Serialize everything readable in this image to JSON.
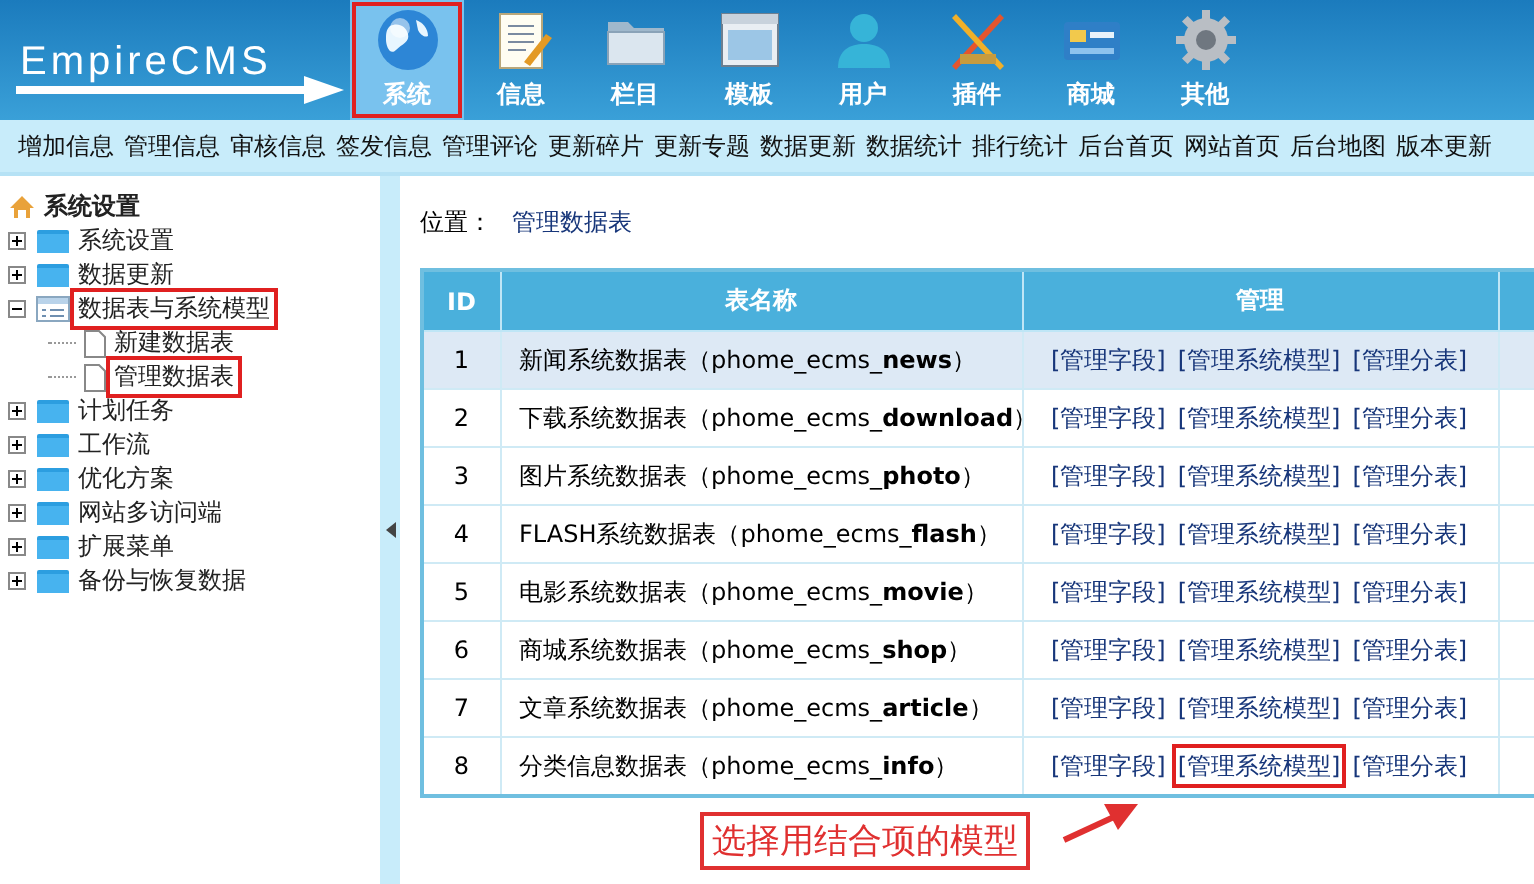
{
  "logo": {
    "text": "EmpireCMS"
  },
  "nav": [
    {
      "label": "系统",
      "selected": true,
      "highlighted": true
    },
    {
      "label": "信息",
      "selected": false,
      "highlighted": false
    },
    {
      "label": "栏目",
      "selected": false,
      "highlighted": false
    },
    {
      "label": "模板",
      "selected": false,
      "highlighted": false
    },
    {
      "label": "用户",
      "selected": false,
      "highlighted": false
    },
    {
      "label": "插件",
      "selected": false,
      "highlighted": false
    },
    {
      "label": "商城",
      "selected": false,
      "highlighted": false
    },
    {
      "label": "其他",
      "selected": false,
      "highlighted": false
    }
  ],
  "quick_links": [
    "增加信息",
    "管理信息",
    "审核信息",
    "签发信息",
    "管理评论",
    "更新碎片",
    "更新专题",
    "数据更新",
    "数据统计",
    "排行统计",
    "后台首页",
    "网站首页",
    "后台地图",
    "版本更新"
  ],
  "sidebar": {
    "root": "系统设置",
    "items": [
      {
        "label": "系统设置",
        "expanded": false,
        "highlighted": false
      },
      {
        "label": "数据更新",
        "expanded": false,
        "highlighted": false
      },
      {
        "label": "数据表与系统模型",
        "expanded": true,
        "highlighted": true,
        "children": [
          {
            "label": "新建数据表",
            "highlighted": false
          },
          {
            "label": "管理数据表",
            "highlighted": true
          }
        ]
      },
      {
        "label": "计划任务",
        "expanded": false,
        "highlighted": false
      },
      {
        "label": "工作流",
        "expanded": false,
        "highlighted": false
      },
      {
        "label": "优化方案",
        "expanded": false,
        "highlighted": false
      },
      {
        "label": "网站多访问端",
        "expanded": false,
        "highlighted": false
      },
      {
        "label": "扩展菜单",
        "expanded": false,
        "highlighted": false
      },
      {
        "label": "备份与恢复数据",
        "expanded": false,
        "highlighted": false
      }
    ]
  },
  "breadcrumb": {
    "label": "位置：",
    "link": "管理数据表"
  },
  "table": {
    "columns": [
      "ID",
      "表名称",
      "管理"
    ],
    "rows": [
      {
        "id": "1",
        "name": "新闻系统数据表（phome_ecms_**news**）",
        "selected": true,
        "actions": [
          {
            "label": "[管理字段]",
            "highlighted": false
          },
          {
            "label": "[管理系统模型]",
            "highlighted": false
          },
          {
            "label": "[管理分表]",
            "highlighted": false
          }
        ]
      },
      {
        "id": "2",
        "name": "下载系统数据表（phome_ecms_**download**）",
        "selected": false,
        "actions": [
          {
            "label": "[管理字段]",
            "highlighted": false
          },
          {
            "label": "[管理系统模型]",
            "highlighted": false
          },
          {
            "label": "[管理分表]",
            "highlighted": false
          }
        ]
      },
      {
        "id": "3",
        "name": "图片系统数据表（phome_ecms_**photo**）",
        "selected": false,
        "actions": [
          {
            "label": "[管理字段]",
            "highlighted": false
          },
          {
            "label": "[管理系统模型]",
            "highlighted": false
          },
          {
            "label": "[管理分表]",
            "highlighted": false
          }
        ]
      },
      {
        "id": "4",
        "name": "FLASH系统数据表（phome_ecms_**flash**）",
        "selected": false,
        "actions": [
          {
            "label": "[管理字段]",
            "highlighted": false
          },
          {
            "label": "[管理系统模型]",
            "highlighted": false
          },
          {
            "label": "[管理分表]",
            "highlighted": false
          }
        ]
      },
      {
        "id": "5",
        "name": "电影系统数据表（phome_ecms_**movie**）",
        "selected": false,
        "actions": [
          {
            "label": "[管理字段]",
            "highlighted": false
          },
          {
            "label": "[管理系统模型]",
            "highlighted": false
          },
          {
            "label": "[管理分表]",
            "highlighted": false
          }
        ]
      },
      {
        "id": "6",
        "name": "商城系统数据表（phome_ecms_**shop**）",
        "selected": false,
        "actions": [
          {
            "label": "[管理字段]",
            "highlighted": false
          },
          {
            "label": "[管理系统模型]",
            "highlighted": false
          },
          {
            "label": "[管理分表]",
            "highlighted": false
          }
        ]
      },
      {
        "id": "7",
        "name": "文章系统数据表（phome_ecms_**article**）",
        "selected": false,
        "actions": [
          {
            "label": "[管理字段]",
            "highlighted": false
          },
          {
            "label": "[管理系统模型]",
            "highlighted": false
          },
          {
            "label": "[管理分表]",
            "highlighted": false
          }
        ]
      },
      {
        "id": "8",
        "name": "分类信息数据表（phome_ecms_**info**）",
        "selected": false,
        "actions": [
          {
            "label": "[管理字段]",
            "highlighted": false
          },
          {
            "label": "[管理系统模型]",
            "highlighted": true
          },
          {
            "label": "[管理分表]",
            "highlighted": false
          }
        ]
      }
    ]
  },
  "annotation": {
    "text": "选择用结合项的模型"
  }
}
